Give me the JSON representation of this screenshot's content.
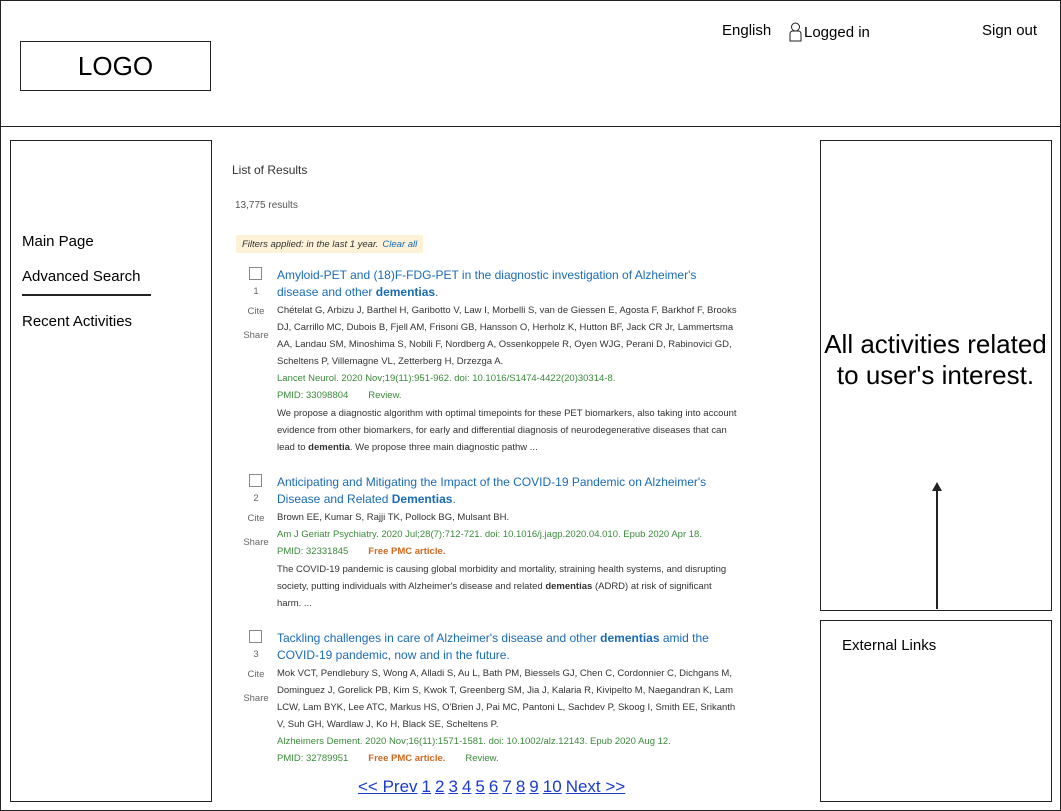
{
  "header": {
    "logo": "LOGO",
    "language": "English",
    "user_status": "Logged in",
    "sign_out": "Sign out"
  },
  "nav": {
    "main_page": "Main Page",
    "advanced_search": "Advanced Search",
    "recent_activities": "Recent Activities"
  },
  "results": {
    "list_title": "List of Results",
    "count": "13,775 results",
    "filter_text": "Filters applied: in the last 1 year.",
    "clear_all": "Clear all",
    "items": [
      {
        "num": "1",
        "cite": "Cite",
        "share": "Share",
        "title_parts": [
          "Amyloid-PET and (18)F-FDG-PET in the diagnostic investigation of Alzheimer's",
          " disease and other ",
          "dementias",
          "."
        ],
        "authors": "Chételat G, Arbizu J, Barthel H, Garibotto V, Law I, Morbelli S, van de Giessen E, Agosta F, Barkhof F, Brooks DJ, Carrillo MC, Dubois B, Fjell AM, Frisoni GB, Hansson O, Herholz K, Hutton BF, Jack CR Jr, Lammertsma AA, Landau SM, Minoshima S, Nobili F, Nordberg A, Ossenkoppele R, Oyen WJG, Perani D, Rabinovici GD, Scheltens P, Villemagne VL, Zetterberg H, Drzezga A.",
        "journal": "Lancet Neurol. 2020 Nov;19(11):951-962. doi: 10.1016/S1474-4422(20)30314-8.",
        "pmid": "PMID: 33098804",
        "badge": "",
        "review": "Review.",
        "abstract": "We propose a diagnostic algorithm with optimal timepoints for these PET biomarkers, also taking into account evidence from other biomarkers, for early and differential diagnosis of neurodegenerative diseases that can lead to",
        "abstract_bold": "dementia",
        "abstract_tail": ". We propose three main diagnostic pathw ..."
      },
      {
        "num": "2",
        "cite": "Cite",
        "share": "Share",
        "title_parts": [
          "Anticipating and Mitigating the Impact of the COVID-19 Pandemic on Alzheimer's Disease and Related ",
          "",
          "Dementias",
          "."
        ],
        "authors": "Brown EE, Kumar S, Rajji TK, Pollock BG, Mulsant BH.",
        "journal": "Am J Geriatr Psychiatry. 2020 Jul;28(7):712-721. doi: 10.1016/j.jagp.2020.04.010. Epub 2020 Apr 18.",
        "pmid": "PMID: 32331845",
        "badge": "Free PMC article.",
        "review": "",
        "abstract": "The COVID-19 pandemic is causing global morbidity and mortality, straining health systems, and disrupting society, putting individuals with Alzheimer's disease and related",
        "abstract_bold": "dementias",
        "abstract_tail": " (ADRD) at risk of significant harm. ..."
      },
      {
        "num": "3",
        "cite": "Cite",
        "share": "Share",
        "title_parts": [
          "Tackling challenges in care of Alzheimer's disease and other ",
          "",
          "dementias",
          " amid the COVID-19 pandemic, now and in the future."
        ],
        "authors": "Mok VCT, Pendlebury S, Wong A, Alladi S, Au L, Bath PM, Biessels GJ, Chen C, Cordonnier C, Dichgans M, Dominguez J, Gorelick PB, Kim S, Kwok T, Greenberg SM, Jia J, Kalaria R, Kivipelto M, Naegandran K, Lam LCW, Lam BYK, Lee ATC, Markus HS, O'Brien J, Pai MC, Pantoni L, Sachdev P, Skoog I, Smith EE, Srikanth V, Suh GH, Wardlaw J, Ko H, Black SE, Scheltens P.",
        "journal": "Alzheimers Dement. 2020 Nov;16(11):1571-1581. doi: 10.1002/alz.12143. Epub 2020 Aug 12.",
        "pmid": "PMID: 32789951",
        "badge": "Free PMC article.",
        "review": "Review.",
        "abstract": "",
        "abstract_bold": "",
        "abstract_tail": ""
      }
    ]
  },
  "pagination": {
    "prev": "<< Prev",
    "pages": [
      "1",
      "2",
      "3",
      "4",
      "5",
      "6",
      "7",
      "8",
      "9",
      "10"
    ],
    "next": "Next >>"
  },
  "right_panel": {
    "interest_text": "All activities related to user's interest.",
    "external_links": "External Links"
  }
}
